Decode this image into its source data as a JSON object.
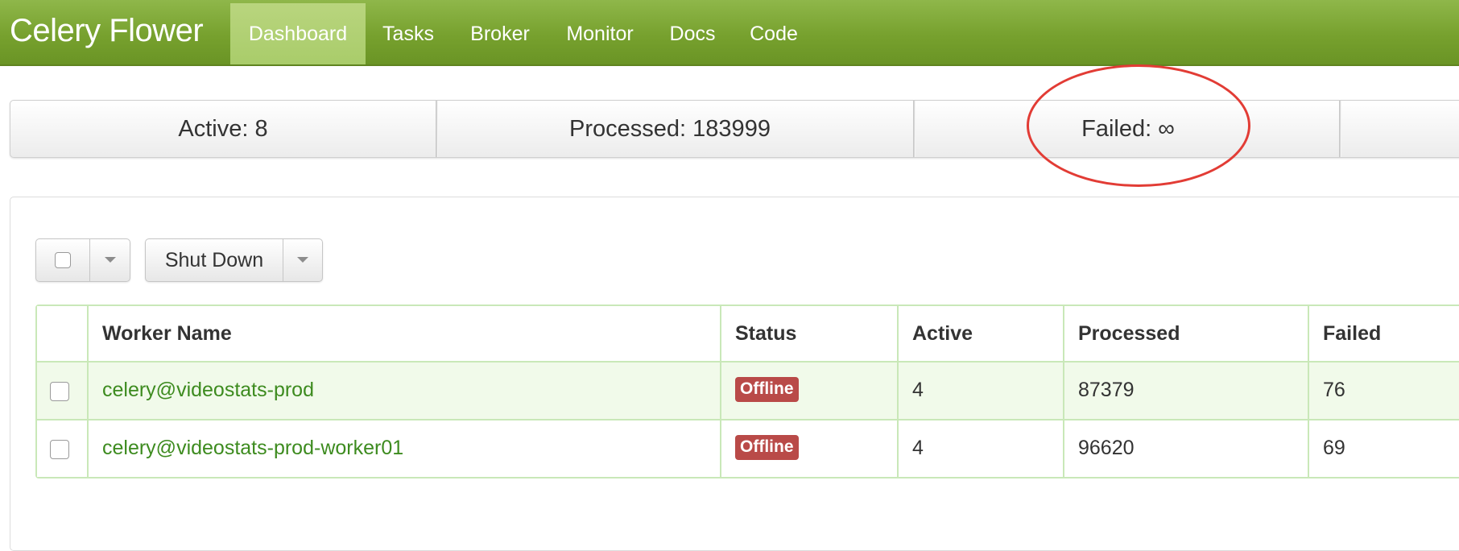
{
  "app": {
    "brand": "Celery Flower"
  },
  "nav": {
    "items": [
      {
        "label": "Dashboard",
        "active": true
      },
      {
        "label": "Tasks",
        "active": false
      },
      {
        "label": "Broker",
        "active": false
      },
      {
        "label": "Monitor",
        "active": false
      },
      {
        "label": "Docs",
        "active": false
      },
      {
        "label": "Code",
        "active": false
      }
    ]
  },
  "stats": {
    "active": "Active: 8",
    "processed": "Processed: 183999",
    "failed": "Failed: ∞"
  },
  "toolbar": {
    "shutdown_label": "Shut Down"
  },
  "table": {
    "columns": [
      "Worker Name",
      "Status",
      "Active",
      "Processed",
      "Failed"
    ],
    "rows": [
      {
        "name": "celery@videostats-prod",
        "status": "Offline",
        "active": "4",
        "processed": "87379",
        "failed": "76"
      },
      {
        "name": "celery@videostats-prod-worker01",
        "status": "Offline",
        "active": "4",
        "processed": "96620",
        "failed": "69"
      }
    ]
  },
  "colors": {
    "navbar": "#77a12e",
    "nav_active": "#a9cc6a",
    "link": "#3d8b1f",
    "offline_badge": "#b94a48",
    "table_border": "#c9e8b8",
    "row_highlight": "#f1faea",
    "annotation": "#e23c35"
  }
}
